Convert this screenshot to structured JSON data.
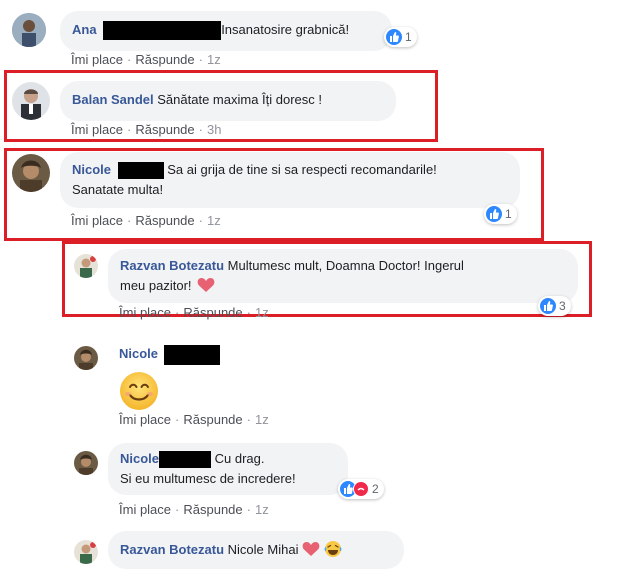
{
  "colors": {
    "name": "#385898",
    "bubble": "#f2f3f5",
    "like": "#2d88ff",
    "highlight": "#dc1e27"
  },
  "actions": {
    "like": "Îmi place",
    "reply": "Răspunde",
    "sep": "·"
  },
  "comments": [
    {
      "name": "Ana",
      "text": "Insanatosire grabnică!",
      "time": "1z",
      "reactions": "1"
    },
    {
      "name": "Balan Sandel",
      "text": "Sănătate maxima Îți doresc !",
      "time": "3h"
    },
    {
      "name": "Nicole",
      "text_line1": "Sa ai grija de tine si sa respecti recomandarile!",
      "text_line2": "Sanatate multa!",
      "time": "1z",
      "reactions": "1"
    },
    {
      "name": "Razvan Botezatu",
      "text_line1": "Multumesc mult, Doamna Doctor! Ingerul",
      "text_line2": "meu pazitor!",
      "time": "1z",
      "reactions": "3"
    },
    {
      "name": "Nicole",
      "time": "1z"
    },
    {
      "name": "Nicole",
      "text_line1": "Cu drag.",
      "text_line2": "Si eu multumesc de incredere!",
      "time": "1z",
      "reactions": "2"
    },
    {
      "name": "Razvan Botezatu",
      "text": "Nicole Mihai"
    }
  ]
}
